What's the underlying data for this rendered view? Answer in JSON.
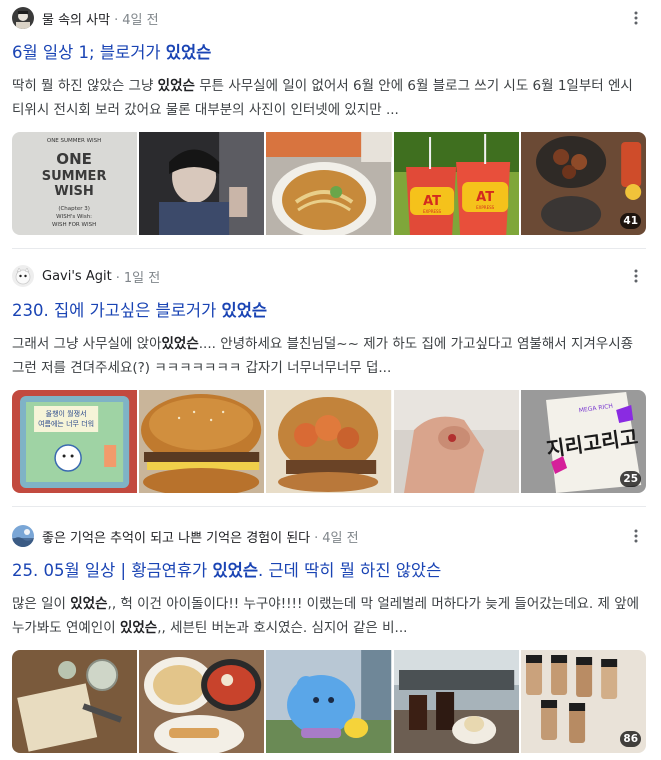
{
  "posts": [
    {
      "author": "물 속의 사막",
      "time": "4일 전",
      "title_parts": [
        "6월 일상 1; 블로거가 ",
        "있었슨",
        ""
      ],
      "excerpt_parts": [
        "딱히 뭘 하진 않았슨 그냥 ",
        "있었슨",
        " 무튼 사무실에 일이 없어서 6월 안에 6월 블로그 쓰기 시도 6월 1일부터 엔시티위시 전시회 보러 갔어요 물론 대부분의 사진이 인터넷에 있지만 ..."
      ],
      "thumb_text": {
        "t1": [
          "ONE SUMMER WISH",
          "ONE",
          "SUMMER",
          "WISH",
          "(Chapter 3)",
          "WISH's Wish:",
          "WISH FOR WISH"
        ],
        "t4": [
          "AT",
          "EXPRESS"
        ]
      },
      "photo_count": "41"
    },
    {
      "author": "Gavi's Agit",
      "time": "1일 전",
      "title_parts": [
        "230. 집에 가고싶은 블로거가 ",
        "있었슨",
        ""
      ],
      "excerpt_parts": [
        "그래서 그냥 사무실에 앉아",
        "있었슨",
        ".... 안녕하세요 블친님덜~~ 제가 하도 집에 가고싶다고 염불해서 지겨우시죵 그런 저를 견뎌주세요(?) ㅋㅋㅋㅋㅋㅋㅋ 갑자기 너무너무너무 덥..."
      ],
      "thumb_text": {
        "t1": [
          "올챙이 월쟁서",
          "여름에는 너무 더워"
        ],
        "t5": [
          "지리고리고",
          "MEGA RICH"
        ]
      },
      "photo_count": "25"
    },
    {
      "author": "좋은 기억은 추억이 되고 나쁜 기억은 경험이 된다",
      "time": "4일 전",
      "title_parts": [
        "25. 05월 일상 | 황금연휴가 ",
        "있었슨",
        ". 근데 딱히 뭘 하진 않았슨"
      ],
      "excerpt_parts": [
        "많은 일이 ",
        "있었슨",
        ",, 헉 이건 아이돌이다!! 누구야!!!! 이랬는데 막 얼레벌레 머하다가 늦게 들어갔는데요. 제 앞에 누가봐도 연예인이 ",
        "있었슨",
        ",, 세븐틴 버논과 호시였슨. 심지어 같은 비..."
      ],
      "photo_count": "86"
    }
  ],
  "more_icon": "more-vertical-icon"
}
